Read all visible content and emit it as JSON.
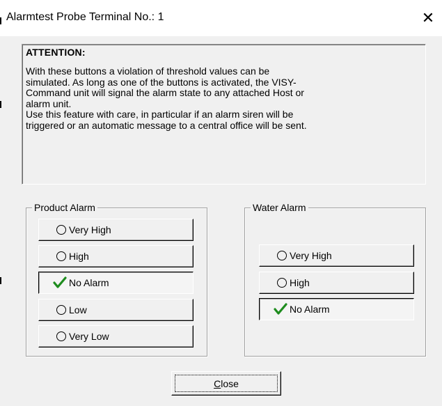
{
  "window": {
    "title": "Alarmtest Probe Terminal No.: 1",
    "close_glyph": "✕"
  },
  "attention": {
    "heading": "ATTENTION:",
    "body": "With these buttons a violation of threshold values can be\nsimulated. As long as one of the buttons is activated, the VISY-\nCommand unit will signal the alarm state to any attached Host or\nalarm unit.\nUse this feature with care, in particular if an alarm siren will be\ntriggered or an automatic message to a central office will be sent."
  },
  "product_alarm": {
    "legend": "Product Alarm",
    "options": [
      {
        "label": "Very High",
        "icon": "radio-empty-icon"
      },
      {
        "label": "High",
        "icon": "radio-empty-icon"
      },
      {
        "label": "No Alarm",
        "icon": "checkmark-icon",
        "active": true
      },
      {
        "label": "Low",
        "icon": "radio-empty-icon"
      },
      {
        "label": "Very Low",
        "icon": "radio-empty-icon"
      }
    ]
  },
  "water_alarm": {
    "legend": "Water Alarm",
    "options": [
      {
        "label": "Very High",
        "icon": "radio-empty-icon"
      },
      {
        "label": "High",
        "icon": "radio-empty-icon"
      },
      {
        "label": "No Alarm",
        "icon": "checkmark-icon",
        "active": true
      }
    ]
  },
  "close_button": {
    "mnemonic": "C",
    "rest": "lose"
  },
  "colors": {
    "face": "#f0f0f0",
    "check": "#1e8c1e"
  }
}
